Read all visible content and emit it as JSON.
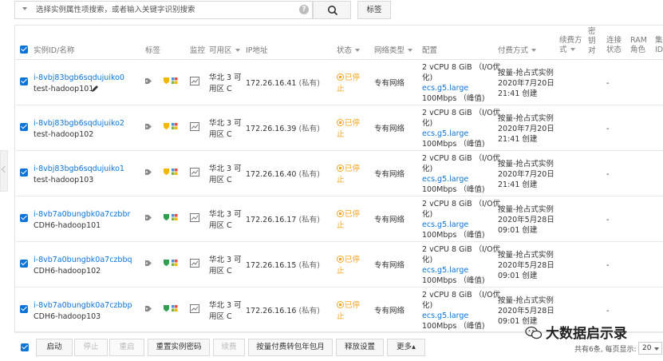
{
  "search": {
    "placeholder": "选择实例属性项搜索，或者输入关键字识别搜索",
    "help": "?",
    "tag_button": "标签"
  },
  "columns": {
    "id_name": "实例ID/名称",
    "tags": "标签",
    "monitor": "监控",
    "zone": "可用区",
    "ip": "IP地址",
    "status": "状态",
    "network": "网络类型",
    "config": "配置",
    "billing": "付费方式",
    "renew": "续费方式",
    "keypair": "密钥对",
    "connection": "连接状态",
    "ram": "RAM角色",
    "cluster": "集ID"
  },
  "rows": [
    {
      "id": "i-8vbj83bgb6sqdujuiko0",
      "name": "test-hadoop101",
      "zone1": "华北 3 可",
      "zone2": "用区 C",
      "ip": "172.26.16.41",
      "ip_tag": "(私有)",
      "status1": "已停",
      "status2": "止",
      "network": "专有网络",
      "cfg1": "2 vCPU 8 GiB （I/O优",
      "cfg2": "化)",
      "cfg3": "ecs.g5.large",
      "cfg4": "100Mbps （峰值)",
      "bill1": "按量-抢占式实例",
      "bill2": "2020年7月20日",
      "bill3": "21:41 创建",
      "dash": "-"
    },
    {
      "id": "i-8vbj83bgb6sqdujuiko2",
      "name": "test-hadoop102",
      "zone1": "华北 3 可",
      "zone2": "用区 C",
      "ip": "172.26.16.39",
      "ip_tag": "(私有)",
      "status1": "已停",
      "status2": "止",
      "network": "专有网络",
      "cfg1": "2 vCPU 8 GiB （I/O优",
      "cfg2": "化)",
      "cfg3": "ecs.g5.large",
      "cfg4": "100Mbps （峰值)",
      "bill1": "按量-抢占式实例",
      "bill2": "2020年7月20日",
      "bill3": "21:41 创建",
      "dash": "-"
    },
    {
      "id": "i-8vbj83bgb6sqdujuiko1",
      "name": "test-hadoop103",
      "zone1": "华北 3 可",
      "zone2": "用区 C",
      "ip": "172.26.16.40",
      "ip_tag": "(私有)",
      "status1": "已停",
      "status2": "止",
      "network": "专有网络",
      "cfg1": "2 vCPU 8 GiB （I/O优",
      "cfg2": "化)",
      "cfg3": "ecs.g5.large",
      "cfg4": "100Mbps （峰值)",
      "bill1": "按量-抢占式实例",
      "bill2": "2020年7月20日",
      "bill3": "21:41 创建",
      "dash": "-"
    },
    {
      "id": "i-8vb7a0bungbk0a7czbbr",
      "name": "CDH6-hadoop101",
      "zone1": "华北 3 可",
      "zone2": "用区 C",
      "ip": "172.26.16.17",
      "ip_tag": "(私有)",
      "status1": "已停",
      "status2": "止",
      "network": "专有网络",
      "cfg1": "2 vCPU 8 GiB （I/O优",
      "cfg2": "化)",
      "cfg3": "ecs.g5.large",
      "cfg4": "100Mbps （峰值)",
      "bill1": "按量-抢占式实例",
      "bill2": "2020年5月28日",
      "bill3": "09:01 创建",
      "dash": "-"
    },
    {
      "id": "i-8vb7a0bungbk0a7czbbq",
      "name": "CDH6-hadoop102",
      "zone1": "华北 3 可",
      "zone2": "用区 C",
      "ip": "172.26.16.15",
      "ip_tag": "(私有)",
      "status1": "已停",
      "status2": "止",
      "network": "专有网络",
      "cfg1": "2 vCPU 8 GiB （I/O优",
      "cfg2": "化)",
      "cfg3": "ecs.g5.large",
      "cfg4": "100Mbps （峰值)",
      "bill1": "按量-抢占式实例",
      "bill2": "2020年5月28日",
      "bill3": "09:01 创建",
      "dash": "-"
    },
    {
      "id": "i-8vb7a0bungbk0a7czbbp",
      "name": "CDH6-hadoop103",
      "zone1": "华北 3 可",
      "zone2": "用区 C",
      "ip": "172.26.16.16",
      "ip_tag": "(私有)",
      "status1": "已停",
      "status2": "止",
      "network": "专有网络",
      "cfg1": "2 vCPU 8 GiB （I/O优",
      "cfg2": "化)",
      "cfg3": "ecs.g5.large",
      "cfg4": "100Mbps （峰值)",
      "bill1": "按量-抢占式实例",
      "bill2": "2020年5月28日",
      "bill3": "09:01 创建",
      "dash": "-"
    }
  ],
  "footer": {
    "start": "启动",
    "stop": "停止",
    "restart": "重启",
    "reset_password": "重置实例密码",
    "renew": "续费",
    "convert_billing": "按量付费转包年包月",
    "release": "释放设置",
    "more": "更多▴",
    "pager": "共有6条, 每页显示:",
    "page_size": "20"
  },
  "watermark": "大数据启示录",
  "colors": {
    "accent": "#0b74d8",
    "stopped": "#f5a623"
  }
}
